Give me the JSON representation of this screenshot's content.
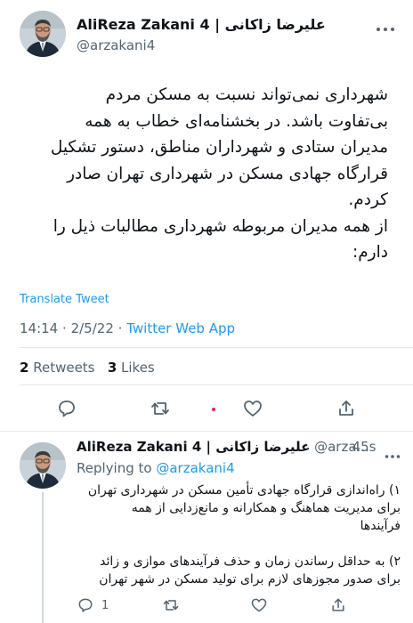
{
  "tweet": {
    "author_name": "AliReza Zakani 4 | علیرضا زاکانی",
    "handle": "@arzakani4",
    "body_lines": [
      "شهرداری نمی‌تواند نسبت به مسکن مردم",
      "بی‌تفاوت باشد. در بخشنامه‌ای خطاب به همه",
      "مدیران ستادی و شهرداران مناطق، دستور تشکیل",
      "قرارگاه جهادی مسکن در شهرداری تهران صادر",
      "کردم.",
      "از همه مدیران مربوطه شهرداری مطالبات ذیل را",
      "دارم:"
    ],
    "translate_label": "Translate Tweet",
    "time": "14:14",
    "date": "2/5/22",
    "separator": "·",
    "source": "Twitter Web App",
    "retweets_count": "2",
    "retweets_label": "Retweets",
    "likes_count": "3",
    "likes_label": "Likes"
  },
  "reply": {
    "author_name": "AliReza Zakani 4 | علیرضا زاکانی",
    "handle": "@arza...",
    "time_ago": "· 45s",
    "replying_prefix": "Replying to",
    "replying_to": "@arzakani4",
    "body_lines": [
      "۱) راه‌اندازی قرارگاه جهادی تأمین مسکن در شهرداری تهران",
      "برای مدیریت هماهنگ و همکارانه و مانع‌زدایی از همه",
      "فرآیندها"
    ],
    "body_lines_2": [
      "۲) به حداقل رساندن زمان و حذف فرآیندهای موازی و زائد",
      "برای صدور مجوزهای لازم برای تولید مسکن در شهر تهران"
    ],
    "reply_count": "1"
  },
  "colors": {
    "accent": "#1d9bf0",
    "text": "#0f1419",
    "muted": "#536471",
    "divider": "#e1e8ed"
  },
  "icons": {
    "more": "more-horizontal-icon",
    "reply": "reply-icon",
    "retweet": "retweet-icon",
    "like": "heart-icon",
    "share": "share-icon"
  }
}
